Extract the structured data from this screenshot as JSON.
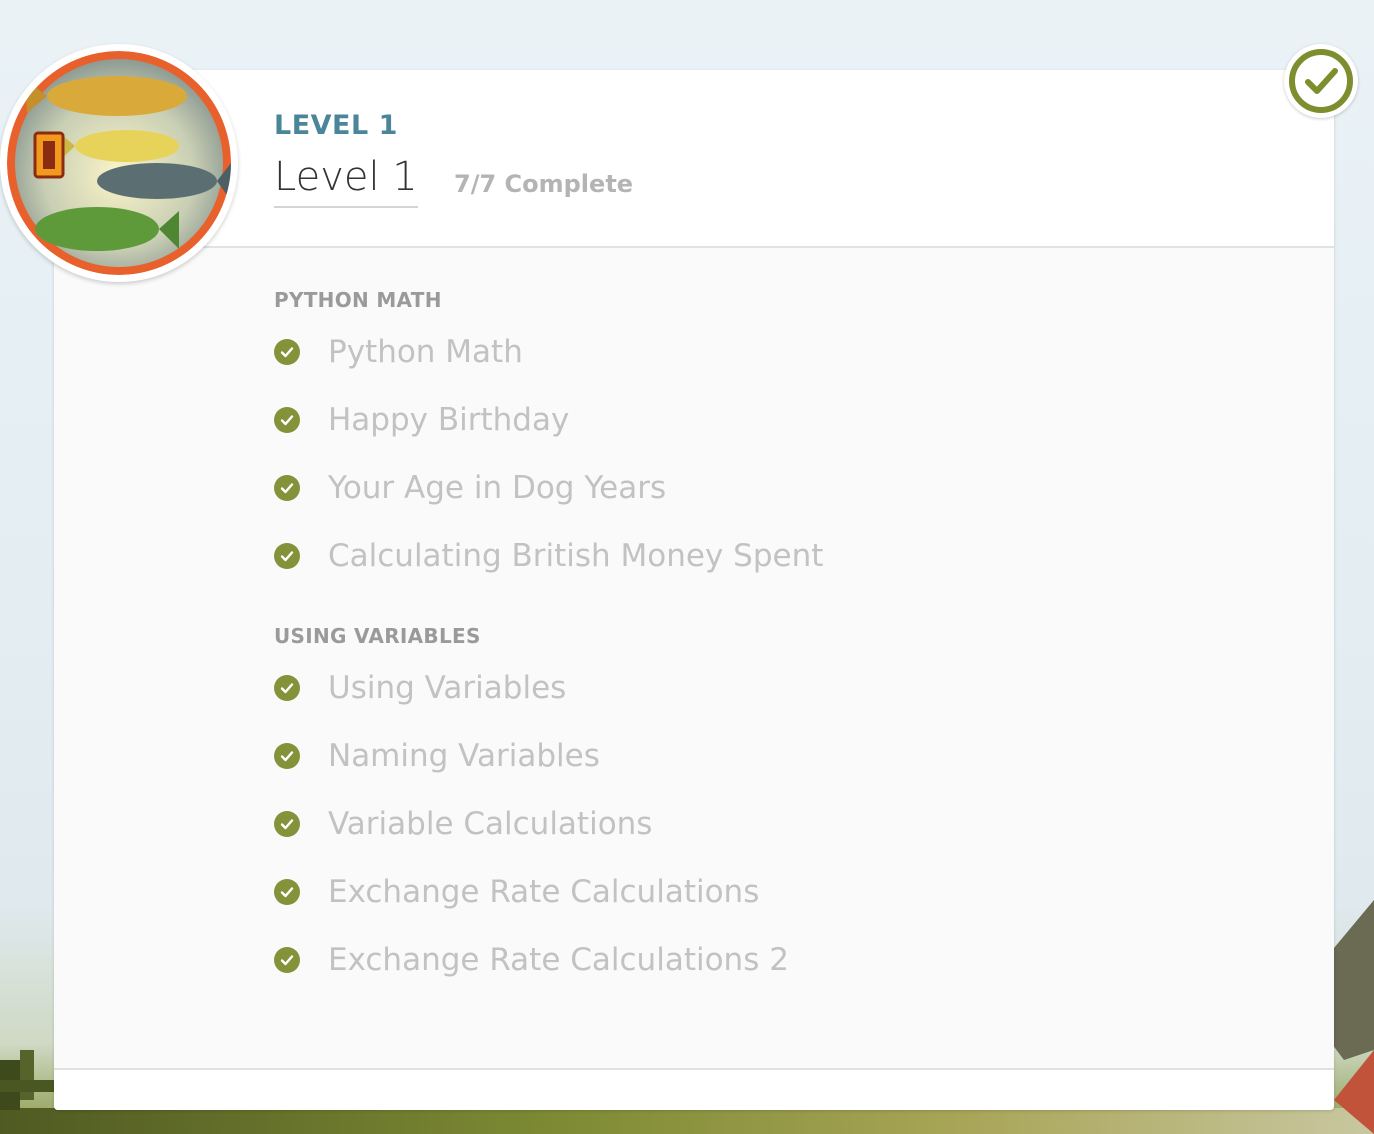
{
  "header": {
    "kicker": "LEVEL 1",
    "title": "Level 1",
    "progress": "7/7 Complete"
  },
  "colors": {
    "accent": "#4a8599",
    "check": "#84933a",
    "badge_ring": "#e8612c"
  },
  "icons": {
    "complete": "check-circle-icon",
    "lesson_done": "check-icon"
  },
  "sections": [
    {
      "title": "PYTHON MATH",
      "lessons": [
        {
          "label": "Python Math",
          "done": true
        },
        {
          "label": "Happy Birthday",
          "done": true
        },
        {
          "label": "Your Age in Dog Years",
          "done": true
        },
        {
          "label": "Calculating British Money Spent",
          "done": true
        }
      ]
    },
    {
      "title": "USING VARIABLES",
      "lessons": [
        {
          "label": "Using Variables",
          "done": true
        },
        {
          "label": "Naming Variables",
          "done": true
        },
        {
          "label": "Variable Calculations",
          "done": true
        },
        {
          "label": "Exchange Rate Calculations",
          "done": true
        },
        {
          "label": "Exchange Rate Calculations 2",
          "done": true
        }
      ]
    }
  ]
}
